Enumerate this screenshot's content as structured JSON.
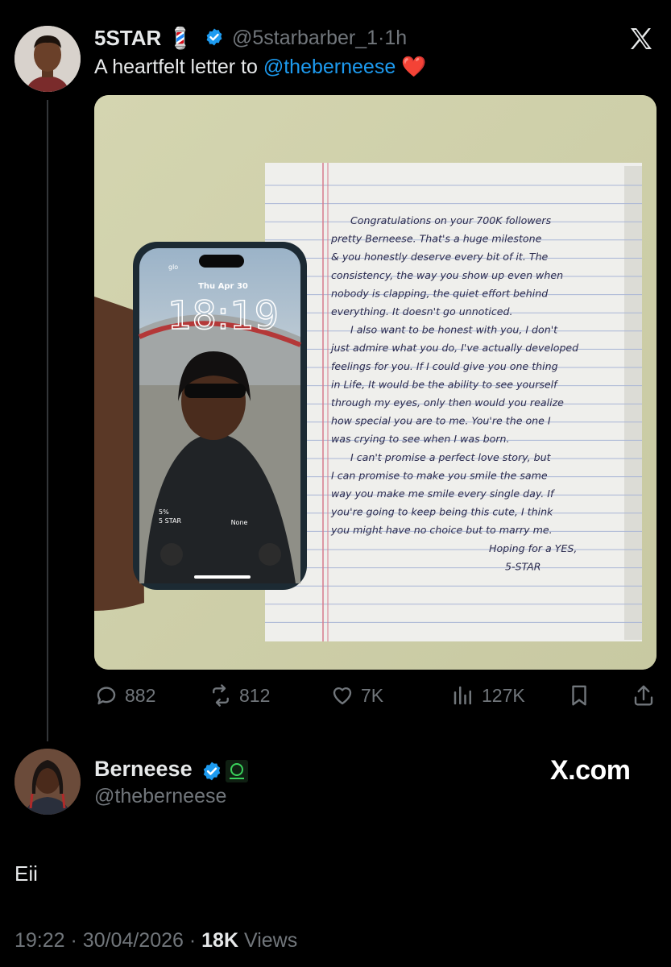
{
  "tweet": {
    "author_name": "5STAR",
    "author_emoji": "💈",
    "handle": "@5starbarber_1",
    "separator": "·",
    "time_ago": "1h",
    "text_prefix": "A heartfelt letter to ",
    "mention": "@theberneese",
    "text_emoji": "❤️",
    "actions": {
      "replies": "882",
      "reposts": "812",
      "likes": "7K",
      "views": "127K"
    }
  },
  "media": {
    "phone": {
      "carrier": "glo",
      "date": "Thu Apr 30",
      "time": "18:19",
      "battery_widget": "5%",
      "widget_label": "5 STAR",
      "focus_label": "None"
    },
    "letter": {
      "lines": [
        "Congratulations on your 700K followers",
        "pretty Berneese. That's a huge milestone",
        "& you honestly deserve every bit of it. The",
        "consistency, the way you show up even when",
        "nobody is clapping, the quiet effort behind",
        "everything. It doesn't go unnoticed.",
        "I also want to be honest with you, I don't",
        "just admire what you do, I've actually developed",
        "feelings for you. If I could give you one thing",
        "in Life, It would be the ability to see yourself",
        "through my eyes, only then would you realize",
        "how special you are to me. You're the one I",
        "was crying to see when I was born.",
        "I can't promise a perfect love story, but",
        "I can promise to make you smile the same",
        "way you make me smile every single day. If",
        "you're going to keep being this cute, I think",
        "you might have no choice but to marry me.",
        "Hoping for a YES,",
        "5-STAR"
      ]
    }
  },
  "reply": {
    "author_name": "Berneese",
    "handle": "@theberneese",
    "text": "Eii",
    "time": "19:22",
    "separator": "·",
    "date": "30/04/2026",
    "views_count": "18K",
    "views_label": " Views",
    "watermark": "X.com"
  },
  "colors": {
    "background": "#000000",
    "text": "#e7e9ea",
    "muted": "#71767b",
    "accent": "#1d9bf0",
    "heart": "#f91880"
  }
}
